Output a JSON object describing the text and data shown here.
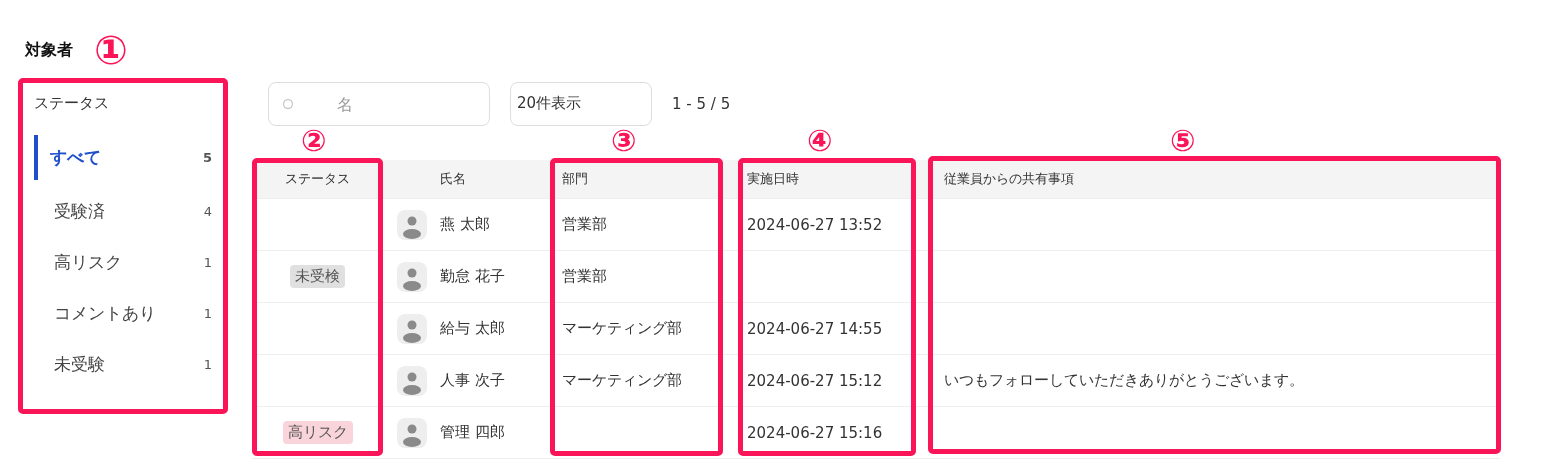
{
  "title": "対象者",
  "sidebar": {
    "heading": "ステータス",
    "items": [
      {
        "label": "すべて",
        "count": "5",
        "selected": true
      },
      {
        "label": "受験済",
        "count": "4",
        "selected": false
      },
      {
        "label": "高リスク",
        "count": "1",
        "selected": false
      },
      {
        "label": "コメントあり",
        "count": "1",
        "selected": false
      },
      {
        "label": "未受験",
        "count": "1",
        "selected": false
      }
    ]
  },
  "search": {
    "placeholder": "名"
  },
  "page_size": "20件表示",
  "range": "1 - 5 / 5",
  "table": {
    "columns": [
      "ステータス",
      "",
      "氏名",
      "部門",
      "実施日時",
      "従業員からの共有事項"
    ],
    "rows": [
      {
        "status": null,
        "name": "燕 太郎",
        "dept": "営業部",
        "date": "2024-06-27 13:52",
        "comment": ""
      },
      {
        "status": {
          "label": "未受検",
          "kind": "untested"
        },
        "name": "勤怠 花子",
        "dept": "営業部",
        "date": "",
        "comment": ""
      },
      {
        "status": null,
        "name": "給与 太郎",
        "dept": "マーケティング部",
        "date": "2024-06-27 14:55",
        "comment": ""
      },
      {
        "status": null,
        "name": "人事 次子",
        "dept": "マーケティング部",
        "date": "2024-06-27 15:12",
        "comment": "いつもフォローしていただきありがとうございます。"
      },
      {
        "status": {
          "label": "高リスク",
          "kind": "risk"
        },
        "name": "管理 四郎",
        "dept": "",
        "date": "2024-06-27 15:16",
        "comment": ""
      }
    ]
  },
  "annotations": [
    "①",
    "②",
    "③",
    "④",
    "⑤"
  ]
}
